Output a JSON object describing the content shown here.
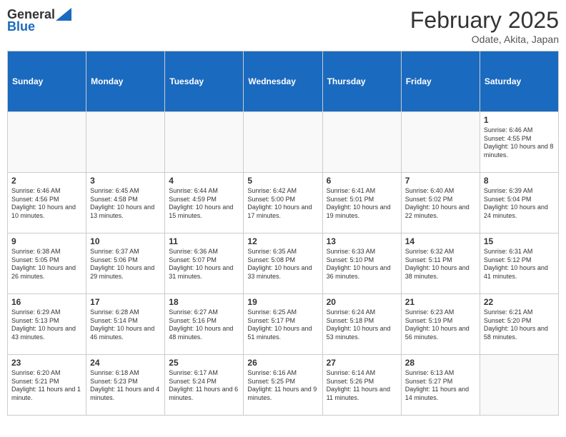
{
  "header": {
    "logo_general": "General",
    "logo_blue": "Blue",
    "month_title": "February 2025",
    "location": "Odate, Akita, Japan"
  },
  "days_of_week": [
    "Sunday",
    "Monday",
    "Tuesday",
    "Wednesday",
    "Thursday",
    "Friday",
    "Saturday"
  ],
  "weeks": [
    [
      {
        "day": "",
        "content": ""
      },
      {
        "day": "",
        "content": ""
      },
      {
        "day": "",
        "content": ""
      },
      {
        "day": "",
        "content": ""
      },
      {
        "day": "",
        "content": ""
      },
      {
        "day": "",
        "content": ""
      },
      {
        "day": "1",
        "content": "Sunrise: 6:46 AM\nSunset: 4:55 PM\nDaylight: 10 hours and 8 minutes."
      }
    ],
    [
      {
        "day": "2",
        "content": "Sunrise: 6:46 AM\nSunset: 4:56 PM\nDaylight: 10 hours and 10 minutes."
      },
      {
        "day": "3",
        "content": "Sunrise: 6:45 AM\nSunset: 4:58 PM\nDaylight: 10 hours and 13 minutes."
      },
      {
        "day": "4",
        "content": "Sunrise: 6:44 AM\nSunset: 4:59 PM\nDaylight: 10 hours and 15 minutes."
      },
      {
        "day": "5",
        "content": "Sunrise: 6:42 AM\nSunset: 5:00 PM\nDaylight: 10 hours and 17 minutes."
      },
      {
        "day": "6",
        "content": "Sunrise: 6:41 AM\nSunset: 5:01 PM\nDaylight: 10 hours and 19 minutes."
      },
      {
        "day": "7",
        "content": "Sunrise: 6:40 AM\nSunset: 5:02 PM\nDaylight: 10 hours and 22 minutes."
      },
      {
        "day": "8",
        "content": "Sunrise: 6:39 AM\nSunset: 5:04 PM\nDaylight: 10 hours and 24 minutes."
      }
    ],
    [
      {
        "day": "9",
        "content": "Sunrise: 6:38 AM\nSunset: 5:05 PM\nDaylight: 10 hours and 26 minutes."
      },
      {
        "day": "10",
        "content": "Sunrise: 6:37 AM\nSunset: 5:06 PM\nDaylight: 10 hours and 29 minutes."
      },
      {
        "day": "11",
        "content": "Sunrise: 6:36 AM\nSunset: 5:07 PM\nDaylight: 10 hours and 31 minutes."
      },
      {
        "day": "12",
        "content": "Sunrise: 6:35 AM\nSunset: 5:08 PM\nDaylight: 10 hours and 33 minutes."
      },
      {
        "day": "13",
        "content": "Sunrise: 6:33 AM\nSunset: 5:10 PM\nDaylight: 10 hours and 36 minutes."
      },
      {
        "day": "14",
        "content": "Sunrise: 6:32 AM\nSunset: 5:11 PM\nDaylight: 10 hours and 38 minutes."
      },
      {
        "day": "15",
        "content": "Sunrise: 6:31 AM\nSunset: 5:12 PM\nDaylight: 10 hours and 41 minutes."
      }
    ],
    [
      {
        "day": "16",
        "content": "Sunrise: 6:29 AM\nSunset: 5:13 PM\nDaylight: 10 hours and 43 minutes."
      },
      {
        "day": "17",
        "content": "Sunrise: 6:28 AM\nSunset: 5:14 PM\nDaylight: 10 hours and 46 minutes."
      },
      {
        "day": "18",
        "content": "Sunrise: 6:27 AM\nSunset: 5:16 PM\nDaylight: 10 hours and 48 minutes."
      },
      {
        "day": "19",
        "content": "Sunrise: 6:25 AM\nSunset: 5:17 PM\nDaylight: 10 hours and 51 minutes."
      },
      {
        "day": "20",
        "content": "Sunrise: 6:24 AM\nSunset: 5:18 PM\nDaylight: 10 hours and 53 minutes."
      },
      {
        "day": "21",
        "content": "Sunrise: 6:23 AM\nSunset: 5:19 PM\nDaylight: 10 hours and 56 minutes."
      },
      {
        "day": "22",
        "content": "Sunrise: 6:21 AM\nSunset: 5:20 PM\nDaylight: 10 hours and 58 minutes."
      }
    ],
    [
      {
        "day": "23",
        "content": "Sunrise: 6:20 AM\nSunset: 5:21 PM\nDaylight: 11 hours and 1 minute."
      },
      {
        "day": "24",
        "content": "Sunrise: 6:18 AM\nSunset: 5:23 PM\nDaylight: 11 hours and 4 minutes."
      },
      {
        "day": "25",
        "content": "Sunrise: 6:17 AM\nSunset: 5:24 PM\nDaylight: 11 hours and 6 minutes."
      },
      {
        "day": "26",
        "content": "Sunrise: 6:16 AM\nSunset: 5:25 PM\nDaylight: 11 hours and 9 minutes."
      },
      {
        "day": "27",
        "content": "Sunrise: 6:14 AM\nSunset: 5:26 PM\nDaylight: 11 hours and 11 minutes."
      },
      {
        "day": "28",
        "content": "Sunrise: 6:13 AM\nSunset: 5:27 PM\nDaylight: 11 hours and 14 minutes."
      },
      {
        "day": "",
        "content": ""
      }
    ]
  ]
}
